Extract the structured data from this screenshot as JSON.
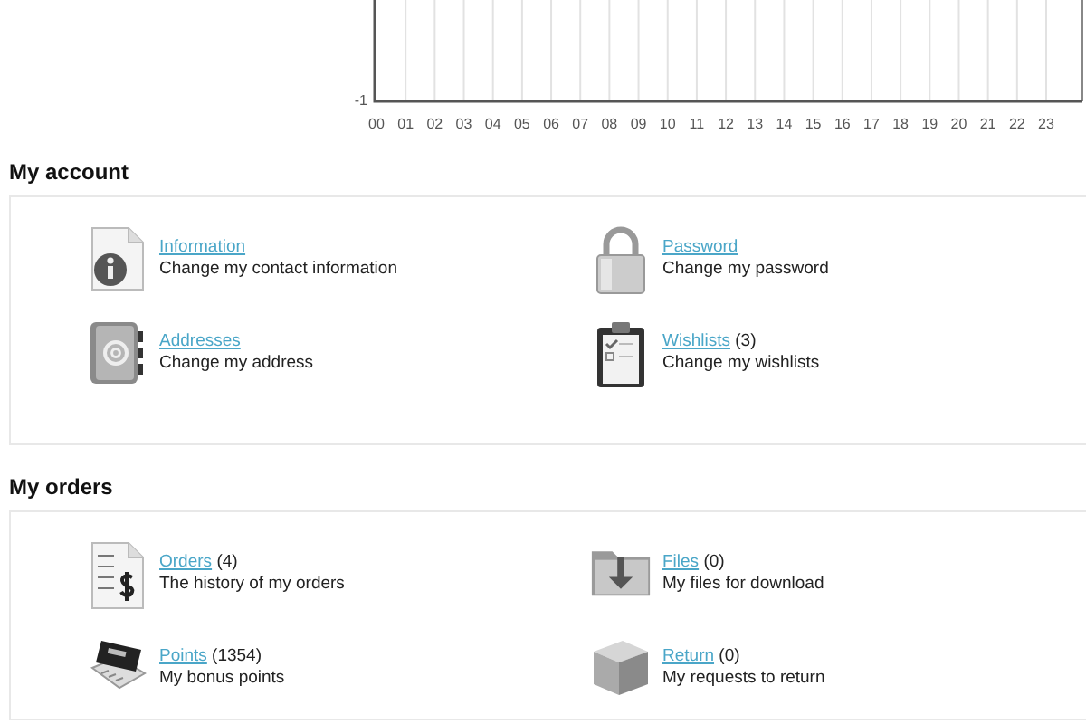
{
  "chart": {
    "x_tick_labels": [
      "00",
      "01",
      "02",
      "03",
      "04",
      "05",
      "06",
      "07",
      "08",
      "09",
      "10",
      "11",
      "12",
      "13",
      "14",
      "15",
      "16",
      "17",
      "18",
      "19",
      "20",
      "21",
      "22",
      "23"
    ],
    "y_tick_label": "-1"
  },
  "sections": [
    {
      "title": "My account",
      "items": [
        {
          "link": "Information",
          "description": "Change my contact information"
        },
        {
          "link": "Password",
          "description": "Change my password"
        },
        {
          "link": "Addresses",
          "description": "Change my address"
        },
        {
          "link": "Wishlists",
          "count": "(3)",
          "description": "Change my wishlists"
        }
      ]
    },
    {
      "title": "My orders",
      "items": [
        {
          "link": "Orders",
          "count": "(4)",
          "description": "The history of my orders"
        },
        {
          "link": "Files",
          "count": "(0)",
          "description": "My files for download"
        },
        {
          "link": "Points",
          "count": "(1354)",
          "description": "My bonus points"
        },
        {
          "link": "Return",
          "count": "(0)",
          "description": "My requests to return"
        }
      ]
    }
  ]
}
